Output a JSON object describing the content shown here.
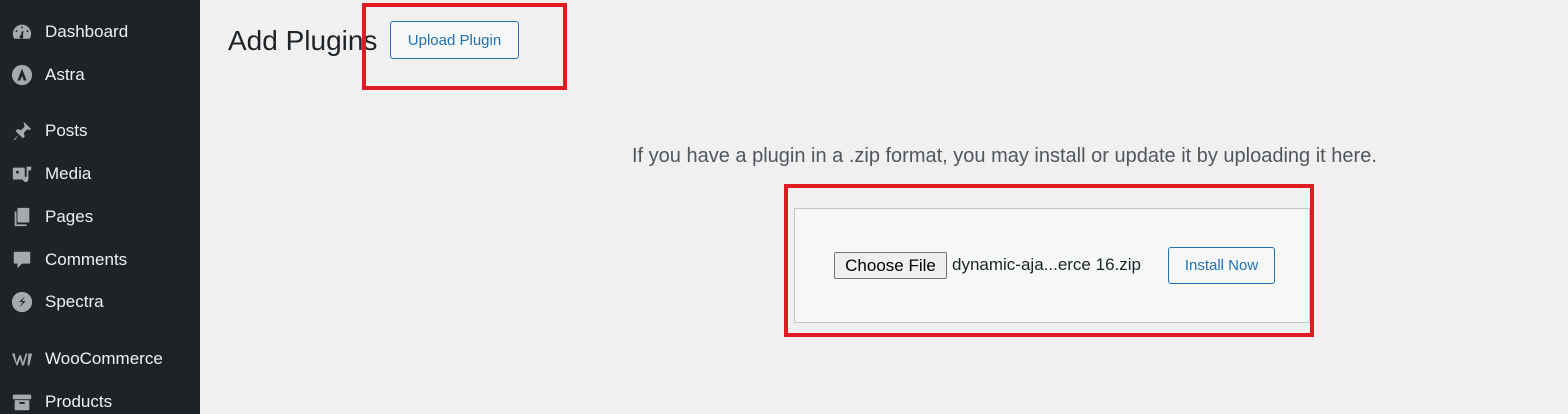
{
  "sidebar": {
    "items": [
      {
        "label": "Dashboard",
        "icon": "dashboard-icon"
      },
      {
        "label": "Astra",
        "icon": "astra-icon"
      },
      {
        "label": "Posts",
        "icon": "pin-icon"
      },
      {
        "label": "Media",
        "icon": "media-icon"
      },
      {
        "label": "Pages",
        "icon": "pages-icon"
      },
      {
        "label": "Comments",
        "icon": "comments-icon"
      },
      {
        "label": "Spectra",
        "icon": "spectra-icon"
      },
      {
        "label": "WooCommerce",
        "icon": "woocommerce-icon"
      },
      {
        "label": "Products",
        "icon": "products-icon"
      }
    ]
  },
  "header": {
    "title": "Add Plugins",
    "upload_button": "Upload Plugin"
  },
  "upload": {
    "help_text": "If you have a plugin in a .zip format, you may install or update it by uploading it here.",
    "choose_file_label": "Choose File",
    "file_name": "dynamic-aja...erce 16.zip",
    "install_button": "Install Now"
  },
  "colors": {
    "sidebar_bg": "#1d2327",
    "accent": "#2271b1",
    "highlight": "#e01b24"
  }
}
